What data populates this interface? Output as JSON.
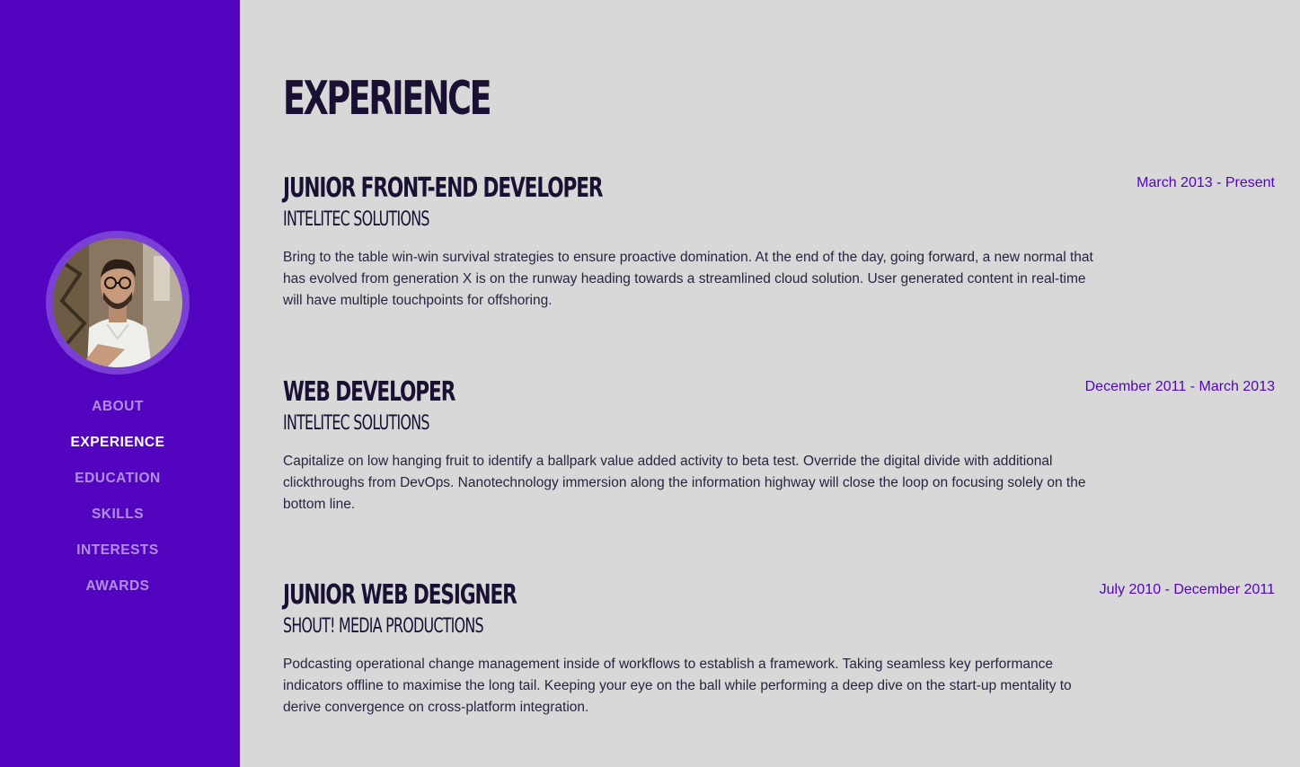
{
  "sidebar": {
    "background_color": "#5204bf",
    "avatar_alt": "profile photo",
    "nav": [
      {
        "label": "ABOUT",
        "active": false
      },
      {
        "label": "EXPERIENCE",
        "active": true
      },
      {
        "label": "EDUCATION",
        "active": false
      },
      {
        "label": "SKILLS",
        "active": false
      },
      {
        "label": "INTERESTS",
        "active": false
      },
      {
        "label": "AWARDS",
        "active": false
      }
    ]
  },
  "main": {
    "title": "EXPERIENCE",
    "jobs": [
      {
        "title": "JUNIOR FRONT-END DEVELOPER",
        "company": "INTELITEC SOLUTIONS",
        "date": "March 2013 - Present",
        "description": "Bring to the table win-win survival strategies to ensure proactive domination. At the end of the day, going forward, a new normal that has evolved from generation X is on the runway heading towards a streamlined cloud solution. User generated content in real-time will have multiple touchpoints for offshoring."
      },
      {
        "title": "WEB DEVELOPER",
        "company": "INTELITEC SOLUTIONS",
        "date": "December 2011 - March 2013",
        "description": "Capitalize on low hanging fruit to identify a ballpark value added activity to beta test. Override the digital divide with additional clickthroughs from DevOps. Nanotechnology immersion along the information highway will close the loop on focusing solely on the bottom line."
      },
      {
        "title": "JUNIOR WEB DESIGNER",
        "company": "SHOUT! MEDIA PRODUCTIONS",
        "date": "July 2010 - December 2011",
        "description": "Podcasting operational change management inside of workflows to establish a framework. Taking seamless key performance indicators offline to maximise the long tail. Keeping your eye on the ball while performing a deep dive on the start-up mentality to derive convergence on cross-platform integration."
      }
    ]
  },
  "colors": {
    "accent": "#5204bf",
    "page_background": "#d8d8d8",
    "heading": "#1a1033"
  }
}
